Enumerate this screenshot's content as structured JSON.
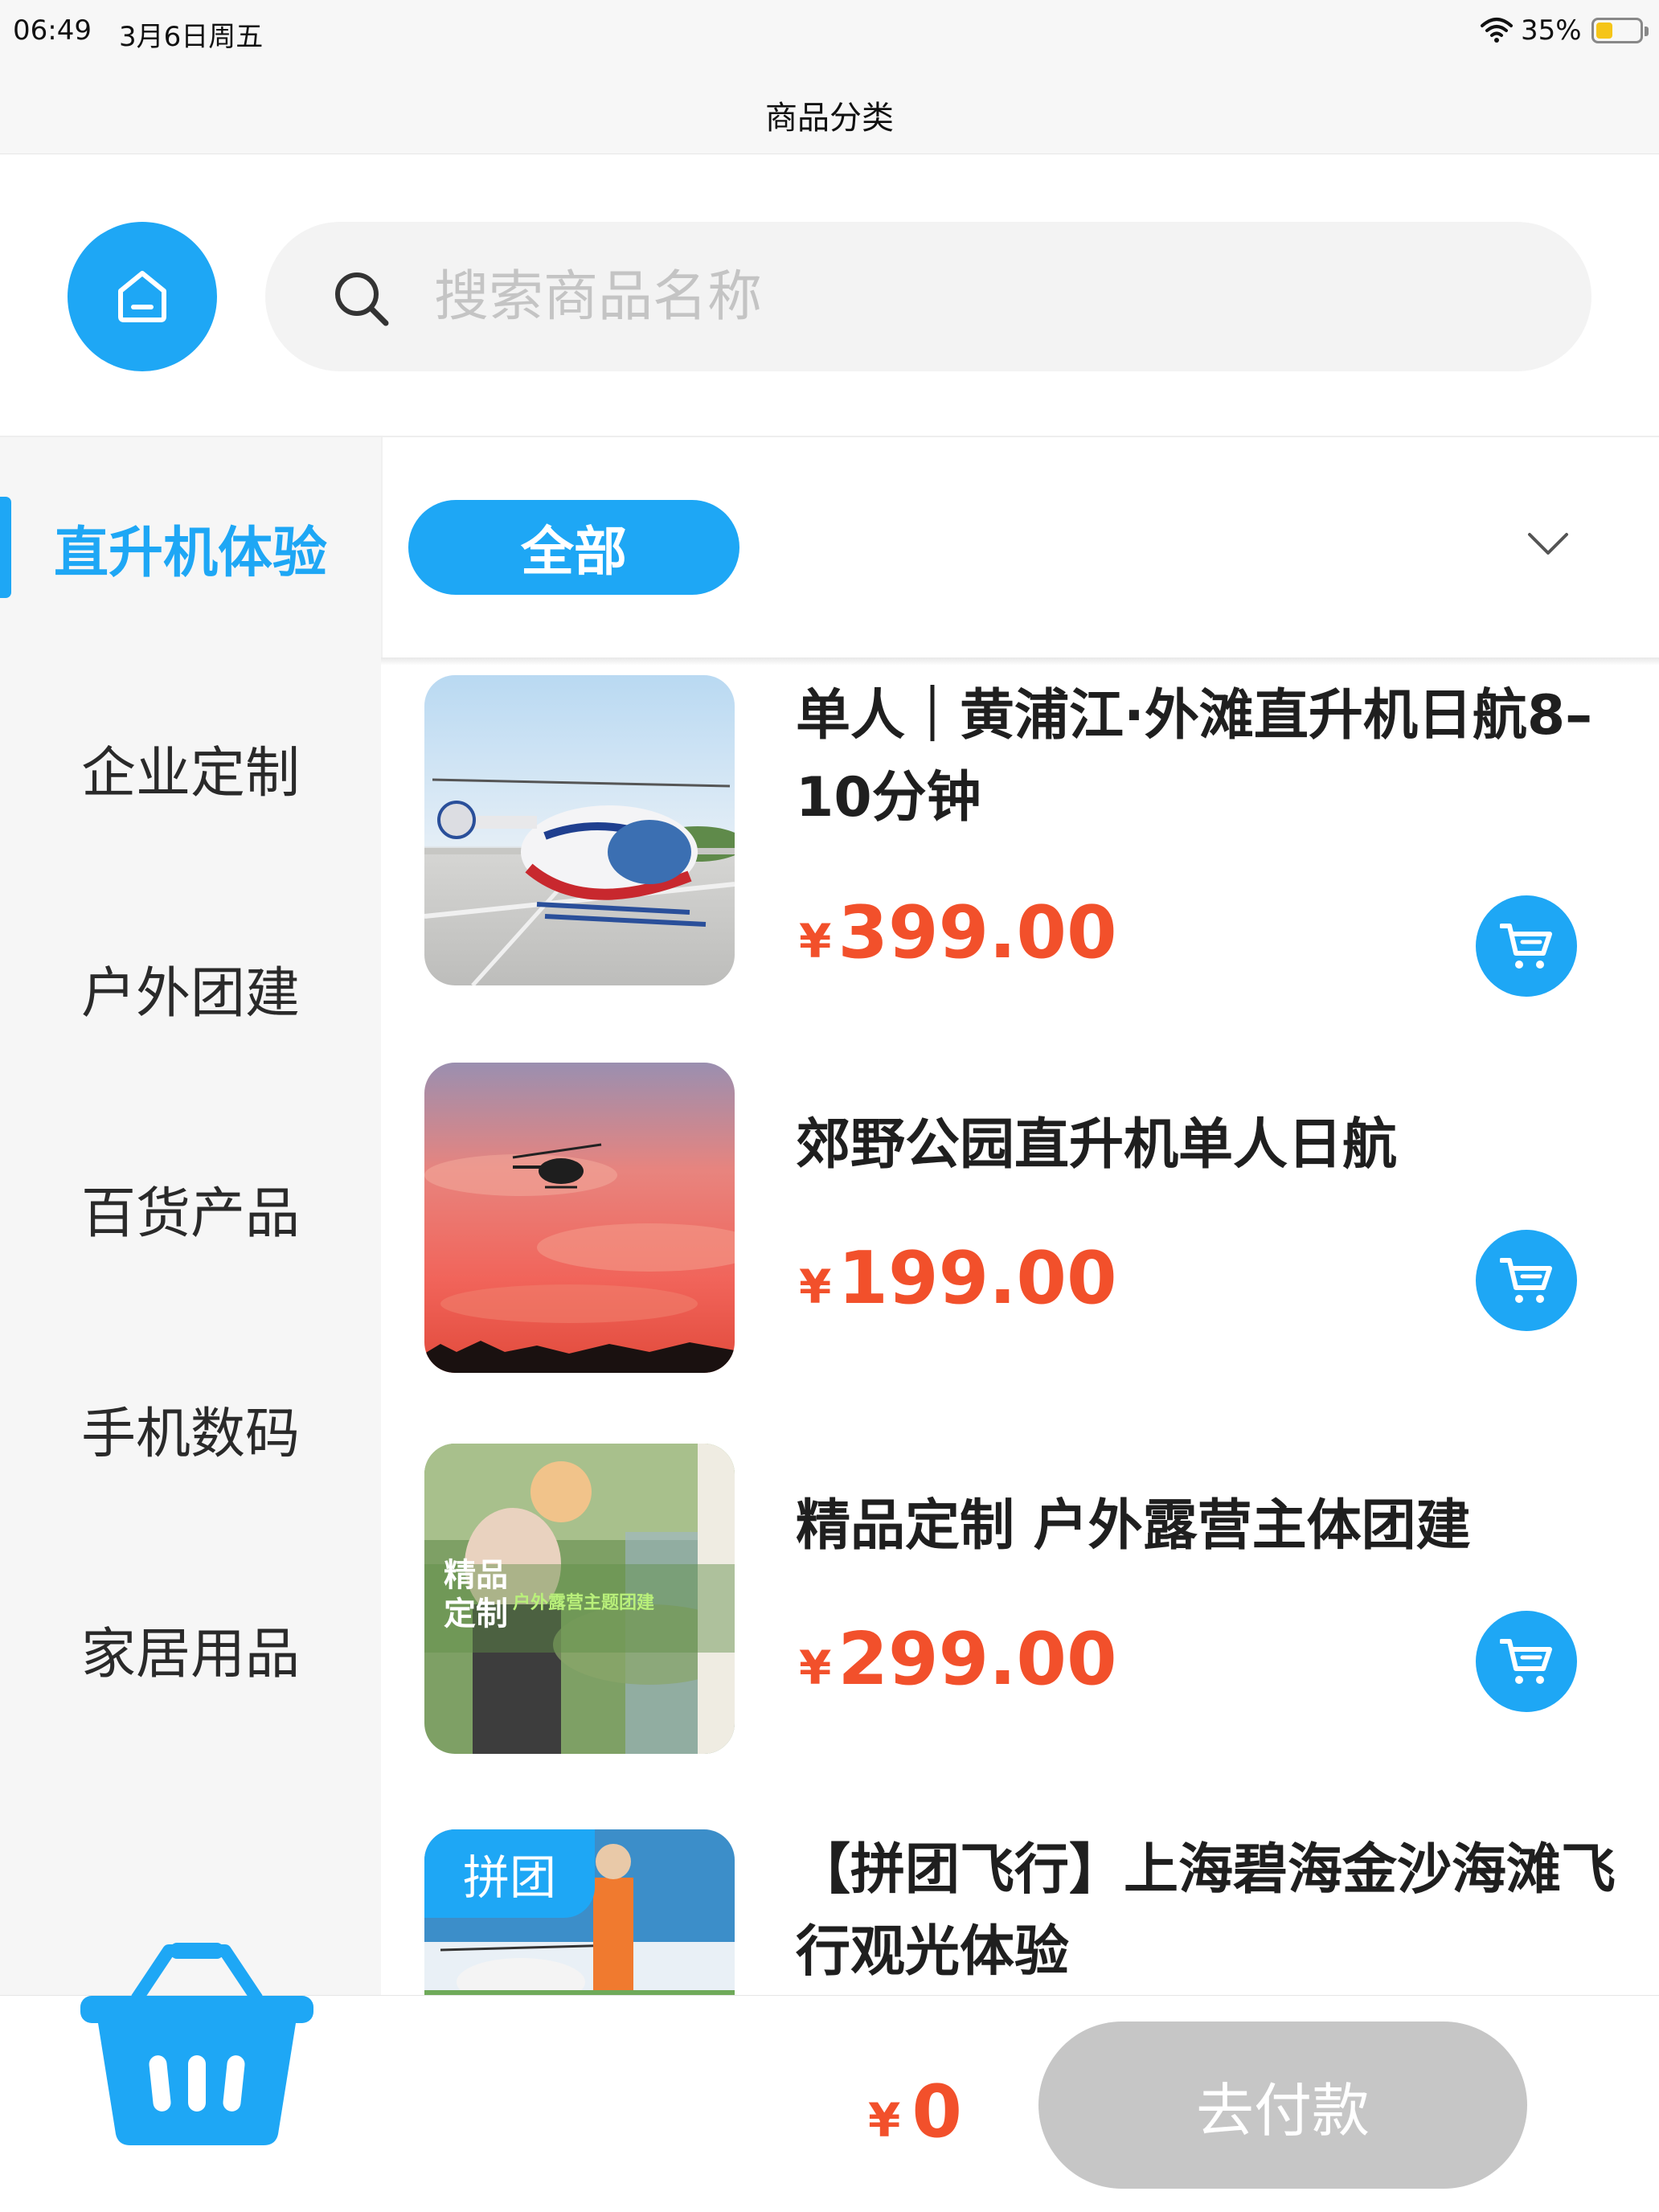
{
  "status_bar": {
    "time": "06:49",
    "date": "3月6日周五",
    "battery_percent": "35%",
    "battery_level": 0.35
  },
  "nav": {
    "title": "商品分类"
  },
  "search": {
    "placeholder": "搜索商品名称",
    "value": ""
  },
  "sidebar": {
    "items": [
      {
        "label": "直升机体验",
        "active": true
      },
      {
        "label": "企业定制",
        "active": false
      },
      {
        "label": "户外团建",
        "active": false
      },
      {
        "label": "百货产品",
        "active": false
      },
      {
        "label": "手机数码",
        "active": false
      },
      {
        "label": "家居用品",
        "active": false
      }
    ]
  },
  "filter": {
    "selected": "全部"
  },
  "products": [
    {
      "title": "单人｜黄浦江·外滩直升机日航8–10分钟",
      "currency": "¥",
      "price": "399.00",
      "image": "helicopter-on-helipad"
    },
    {
      "title": "郊野公园直升机单人日航",
      "currency": "¥",
      "price": "199.00",
      "image": "helicopter-sunset-sky"
    },
    {
      "title": "精品定制 户外露营主体团建",
      "currency": "¥",
      "price": "299.00",
      "image": "outdoor-camping-poster",
      "image_text": [
        "精品",
        "定制",
        "户外露营主题团建"
      ]
    },
    {
      "title": "【拼团飞行】上海碧海金沙海滩飞行观光体验",
      "currency": "¥",
      "price": "",
      "badge": "拼团",
      "image": "beach-helicopter-tour"
    }
  ],
  "bottom_bar": {
    "currency": "¥",
    "total": "0",
    "pay_label": "去付款"
  },
  "colors": {
    "accent": "#1ea7f5",
    "price": "#f2502b",
    "disabled_button": "#c6c6c6"
  }
}
